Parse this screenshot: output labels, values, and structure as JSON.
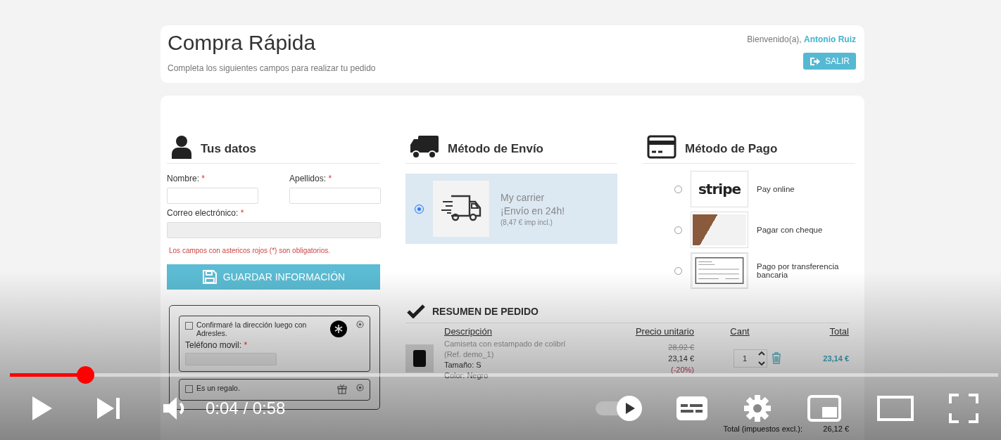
{
  "header": {
    "title": "Compra Rápida",
    "subtitle": "Completa los siguientes campos para realizar tu pedido",
    "welcome": "Bienvenido(a),",
    "user_name": "Antonio Ruiz",
    "logout_button": "SALIR"
  },
  "personal": {
    "heading": "Tus datos",
    "fields": [
      {
        "label": "Nombre:",
        "mark": "*",
        "disabled": false
      },
      {
        "label": "Apellidos:",
        "mark": "*",
        "disabled": false
      },
      {
        "label": "Correo electrónico:",
        "mark": "*",
        "disabled": true
      }
    ],
    "required_note": "Los campos con astericos rojos (*) son obligatorios.",
    "save_button": "GUARDAR INFORMACIÓN",
    "options": [
      {
        "kind": "address",
        "label": "Confirmaré la dirección luego con Adresles.",
        "checked": false,
        "field_label": "Teléfono movil:",
        "field_mark": "*"
      },
      {
        "kind": "gift",
        "label": "Es un regalo.",
        "checked": false
      }
    ]
  },
  "shipping": {
    "heading": "Método de Envío",
    "carriers": [
      {
        "name": "My carrier",
        "delay": "¡Envío en 24h!",
        "price": "(8,47 € imp incl.)",
        "selected": true
      }
    ]
  },
  "payment": {
    "heading": "Método de Pago",
    "methods": [
      {
        "kind": "stripe",
        "logo_text": "stripe",
        "label": "Pay online",
        "selected": false
      },
      {
        "kind": "cheque",
        "label": "Pagar con cheque",
        "selected": false
      },
      {
        "kind": "transfer",
        "label": "Pago por transferencia bancaria",
        "selected": false
      }
    ]
  },
  "summary": {
    "heading": "RESUMEN DE PEDIDO",
    "columns": [
      "Descripción",
      "Precio unitario",
      "Cant",
      "Total"
    ],
    "items": [
      {
        "name": "Camiseta con estampado de colibrí",
        "reference": "(Ref. demo_1)",
        "attributes": [
          "Tamaño: S",
          "Color: Negro"
        ],
        "old_price": "28,92 €",
        "price": "23,14 €",
        "discount": "(-20%)",
        "quantity": "1",
        "total": "23,14 €"
      }
    ],
    "totals": [
      {
        "label": "Total (impuestos excl.):",
        "value": "26,12 €"
      }
    ]
  },
  "player": {
    "progress": {
      "level": 0.076
    },
    "time": "0:04 / 0:58"
  }
}
